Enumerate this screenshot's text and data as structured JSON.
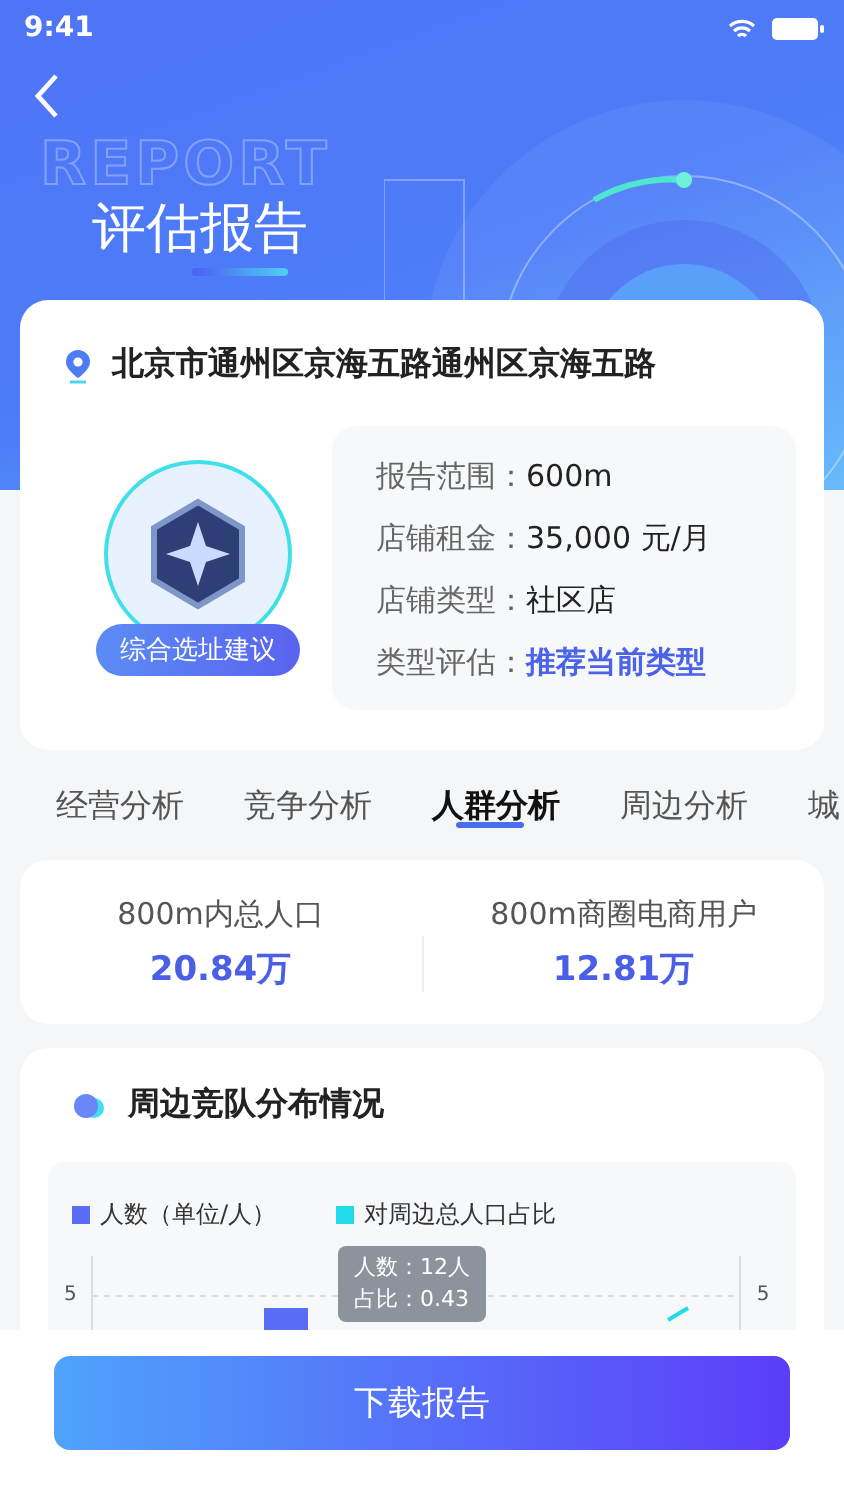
{
  "status_bar": {
    "time": "9:41"
  },
  "header": {
    "title": "评估报告",
    "decoration": "REPORT"
  },
  "location": {
    "address": "北京市通州区京海五路通州区京海五路",
    "badge_label": "综合选址建议",
    "details": [
      {
        "label": "报告范围：",
        "value": "600m",
        "highlight": false
      },
      {
        "label": "店铺租金：",
        "value": "35,000 元/月",
        "highlight": false
      },
      {
        "label": "店铺类型：",
        "value": "社区店",
        "highlight": false
      },
      {
        "label": "类型评估：",
        "value": "推荐当前类型",
        "highlight": true
      }
    ]
  },
  "tabs": [
    {
      "label": "经营分析",
      "selected": false
    },
    {
      "label": "竞争分析",
      "selected": false
    },
    {
      "label": "人群分析",
      "selected": true
    },
    {
      "label": "周边分析",
      "selected": false
    },
    {
      "label": "城",
      "selected": false
    }
  ],
  "stats": [
    {
      "label": "800m内总人口",
      "value": "20.84万"
    },
    {
      "label": "800m商圈电商用户",
      "value": "12.81万"
    }
  ],
  "competition": {
    "title": "周边竞队分布情况",
    "legend": [
      {
        "label": "人数（单位/人）",
        "color": "#5b6cf5"
      },
      {
        "label": "对周边总人口占比",
        "color": "#22dbe8"
      }
    ],
    "left_tick": "5",
    "right_tick": "5",
    "tooltip": [
      "人数：12人",
      "占比：0.43"
    ]
  },
  "download_button": "下载报告"
}
